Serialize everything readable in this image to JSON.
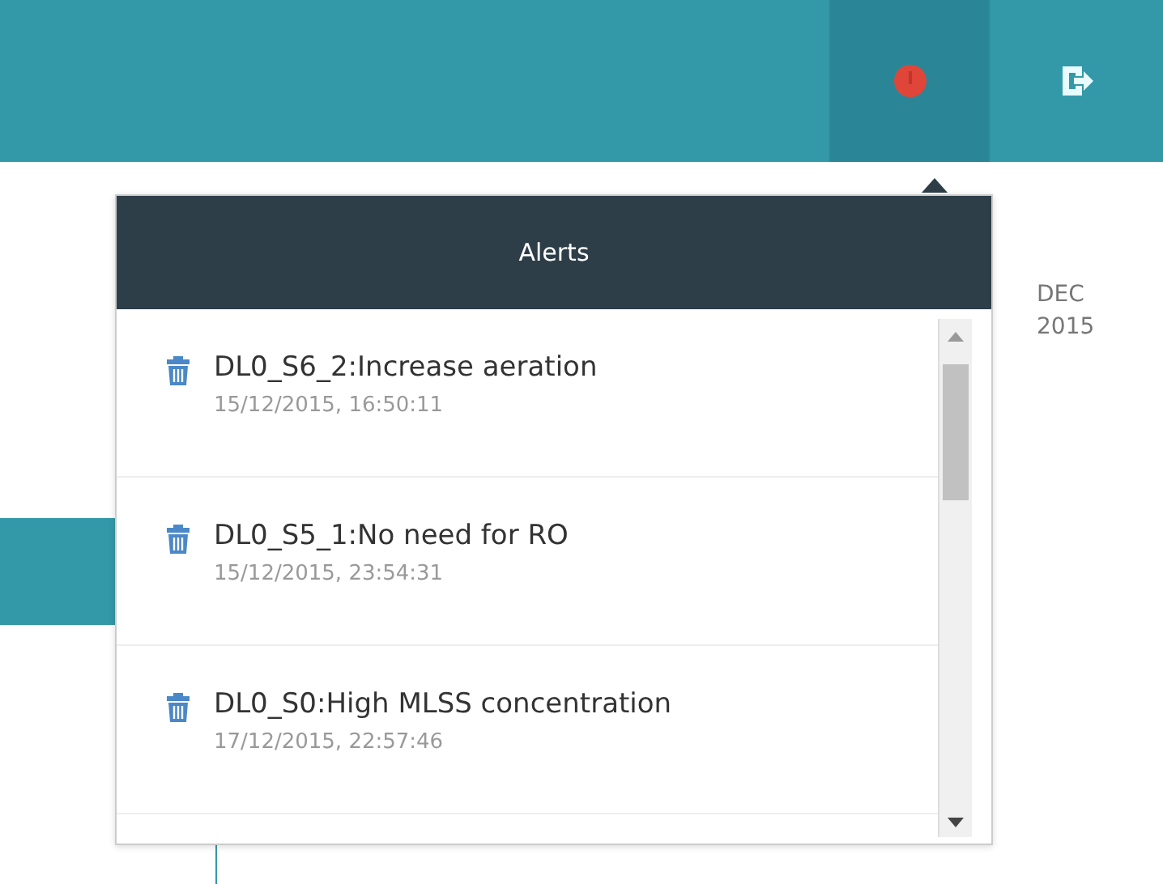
{
  "topbar": {
    "buttons": [
      {
        "kind": "alert",
        "selected": true
      },
      {
        "kind": "logout",
        "selected": false
      }
    ]
  },
  "timeline": {
    "month": "DEC",
    "year": "2015"
  },
  "alerts_popup": {
    "title": "Alerts",
    "items": [
      {
        "message": "DL0_S6_2:Increase aeration",
        "time": "15/12/2015, 16:50:11"
      },
      {
        "message": "DL0_S5_1:No need for RO",
        "time": "15/12/2015, 23:54:31"
      },
      {
        "message": "DL0_S0:High MLSS concentration",
        "time": "17/12/2015, 22:57:46"
      }
    ]
  }
}
